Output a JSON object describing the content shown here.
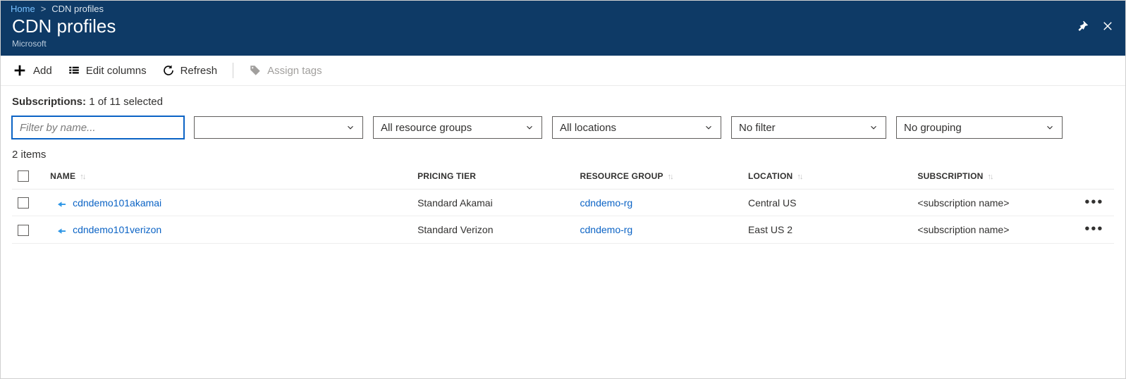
{
  "breadcrumb": {
    "home": "Home",
    "current": "CDN profiles"
  },
  "page": {
    "title": "CDN profiles",
    "subtitle": "Microsoft"
  },
  "toolbar": {
    "add": "Add",
    "edit_columns": "Edit columns",
    "refresh": "Refresh",
    "assign_tags": "Assign tags"
  },
  "subscriptions": {
    "label": "Subscriptions:",
    "value": "1 of 11 selected"
  },
  "filters": {
    "name_placeholder": "Filter by name...",
    "resource_groups": "All resource groups",
    "locations": "All locations",
    "filter": "No filter",
    "grouping": "No grouping"
  },
  "items_count": "2 items",
  "columns": {
    "name": "NAME",
    "pricing_tier": "PRICING TIER",
    "resource_group": "RESOURCE GROUP",
    "location": "LOCATION",
    "subscription": "SUBSCRIPTION"
  },
  "rows": [
    {
      "name": "cdndemo101akamai",
      "pricing_tier": "Standard Akamai",
      "resource_group": "cdndemo-rg",
      "location": "Central US",
      "subscription": "<subscription name>"
    },
    {
      "name": "cdndemo101verizon",
      "pricing_tier": "Standard Verizon",
      "resource_group": "cdndemo-rg",
      "location": "East US 2",
      "subscription": "<subscription name>"
    }
  ]
}
